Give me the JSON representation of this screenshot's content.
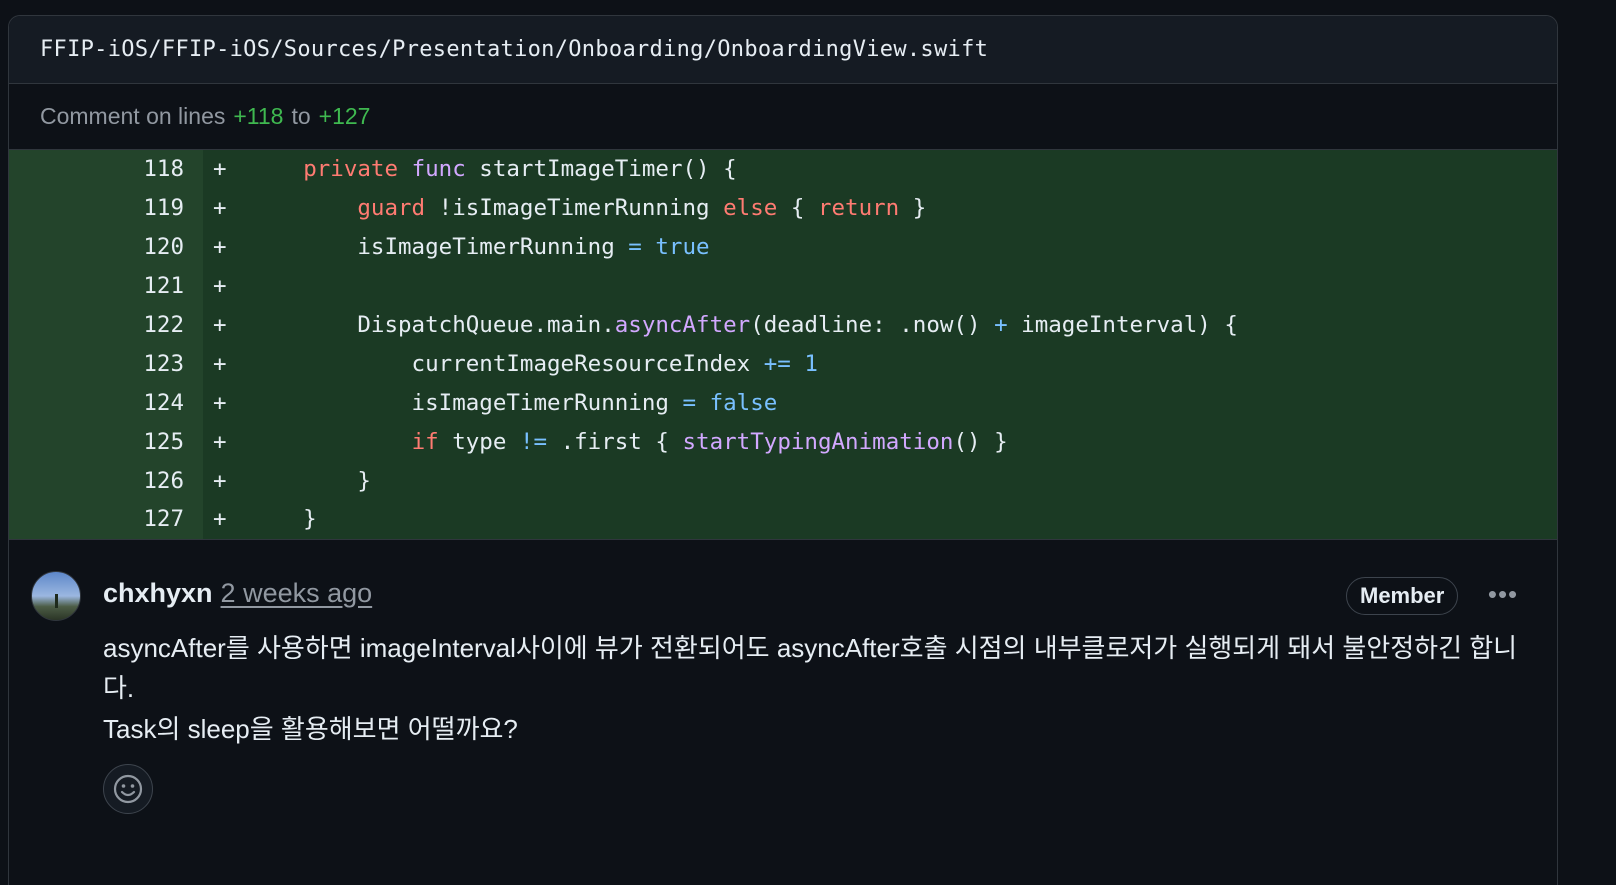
{
  "file": {
    "path": "FFIP-iOS/FFIP-iOS/Sources/Presentation/Onboarding/OnboardingView.swift"
  },
  "comment_range": {
    "prefix": "Comment on lines",
    "start": "+118",
    "middle": "to",
    "end": "+127"
  },
  "diff": {
    "sign": "+",
    "lines": [
      {
        "num": "118"
      },
      {
        "num": "119"
      },
      {
        "num": "120"
      },
      {
        "num": "121"
      },
      {
        "num": "122"
      },
      {
        "num": "123"
      },
      {
        "num": "124"
      },
      {
        "num": "125"
      },
      {
        "num": "126"
      },
      {
        "num": "127"
      }
    ],
    "tokens": {
      "l118": [
        "    ",
        "private",
        " ",
        "func",
        " startImageTimer() {"
      ],
      "l119": [
        "        ",
        "guard",
        " !isImageTimerRunning ",
        "else",
        " { ",
        "return",
        " }"
      ],
      "l120": [
        "        isImageTimerRunning ",
        "=",
        " ",
        "true"
      ],
      "l122": [
        "        DispatchQueue.main.",
        "asyncAfter",
        "(deadline: .now() ",
        "+",
        " imageInterval) {"
      ],
      "l123": [
        "            currentImageResourceIndex ",
        "+=",
        " ",
        "1"
      ],
      "l124": [
        "            isImageTimerRunning ",
        "=",
        " ",
        "false"
      ],
      "l125": [
        "            ",
        "if",
        " type ",
        "!=",
        " .first { ",
        "startTypingAnimation",
        "() }"
      ],
      "l126": [
        "        }"
      ],
      "l127": [
        "    }"
      ]
    }
  },
  "comment": {
    "author": "chxhyxn",
    "time": "2 weeks ago",
    "badge": "Member",
    "more": "•••",
    "body_line1": "asyncAfter를 사용하면 imageInterval사이에 뷰가 전환되어도 asyncAfter호출 시점의 내부클로저가 실행되게 돼서 불안정하긴 합니다.",
    "body_line2": "Task의 sleep을 활용해보면 어떨까요?"
  },
  "colors": {
    "background": "#0d1117",
    "diff_add": "#1b3a24",
    "diff_gutter": "#23442b",
    "keyword": "#ff7b72",
    "function": "#d2a8ff",
    "constant": "#79c0ff",
    "line_ref": "#3fb950"
  },
  "icons": {
    "reaction": "smiley-icon",
    "more": "kebab-horizontal-icon"
  }
}
